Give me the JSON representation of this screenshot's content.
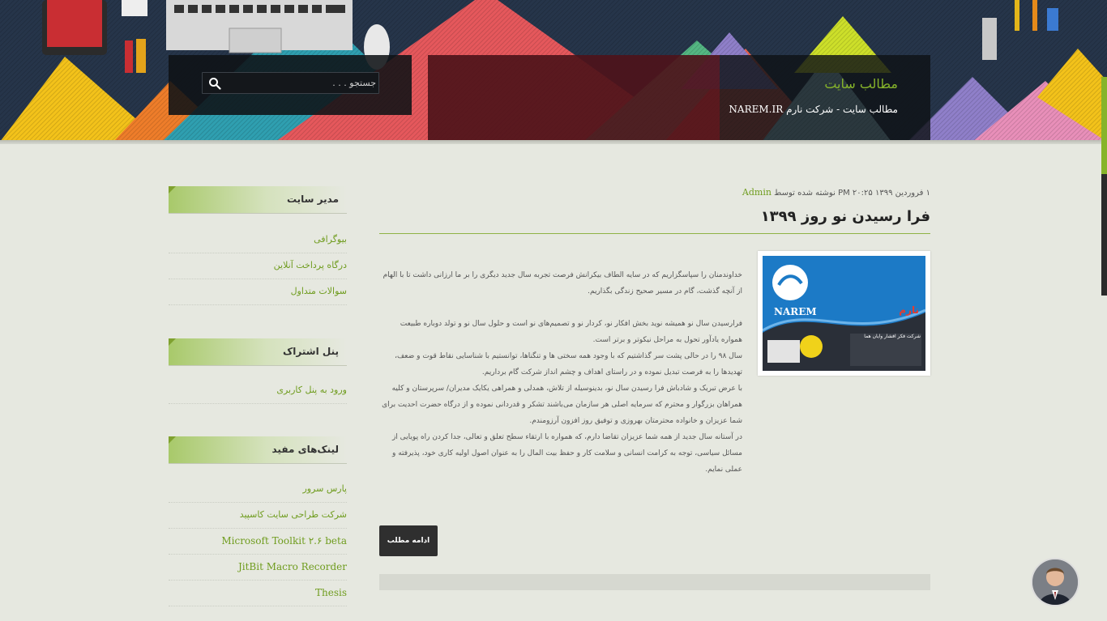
{
  "header": {
    "site_title": "مطالب سایت",
    "site_description": "مطالب سایت - شرکت نارم NAREM.IR",
    "search_placeholder": "جستجو . . ."
  },
  "sidebar": {
    "widgets": [
      {
        "title": "مدیر سایت",
        "links": [
          "بیوگرافی",
          "درگاه پرداخت آنلاین",
          "سوالات متداول"
        ]
      },
      {
        "title": "پنل اشتراک",
        "links": [
          "ورود به پنل کاربری"
        ]
      },
      {
        "title": "لینک‌های مفید",
        "links": [
          "پارس سرور",
          "شرکت طراحی سایت کاسپید",
          "Microsoft Toolkit ۲.۶ beta",
          "JitBit Macro Recorder",
          "Thesis"
        ]
      }
    ]
  },
  "post": {
    "meta_prefix": "۱ فروردین ۱۳۹۹ ۲۰:۲۵ PM نوشته شده توسط",
    "author": "Admin",
    "title": "فرا رسیدن نو روز ۱۳۹۹",
    "paragraphs": [
      "خداوندمنان را سپاسگزاریم که در سایه الطاف بیکرانش فرصت تجربه سال جدید دیگری را بر ما ارزانی داشت تا با الهام از آنچه گذشت، گام در مسیر صحیح زندگی بگذاریم.",
      "فرارسیدن سال نو همیشه نوید بخش افکار نو، کردار نو و تصمیم‌های نو است و حلول سال نو و تولد دوباره طبیعت همواره یادآور تحول به مراحل نیکوتر و برتر است.",
      "سال ۹۸ را در حالی پشت سر گذاشتیم که با وجود همه سختی ها و تنگناها، توانستیم با شناسایی نقاط قوت و ضعف، تهدیدها را به فرصت تبدیل نموده و در راستای اهداف و چشم انداز شرکت گام برداریم.",
      "با عرض تبریک و شادباش فرا رسیدن سال نو، بدینوسیله از تلاش، همدلی و همراهی یکایک مدیران/ سرپرستان و کلیه همراهان بزرگوار و محترم که سرمایه اصلی هر سازمان می‌باشند تشکر و قدردانی نموده و از درگاه حضرت احدیت برای شما عزیزان و خانواده محترمتان بهروزی و توفیق روز افزون آرزومندم.",
      "در آستانه سال جدید از همه شما عزیزان تقاضا دارم، که همواره با ارتقاء سطح تعلق و تعالی، جدا کردن راه پویایی از مسائل سیاسی، توجه به کرامت انسانی و سلامت کار و حفظ بیت المال را به عنوان اصول اولیه کاری خود، پذیرفته و عملی نمایم."
    ],
    "read_more": "ادامه مطلب",
    "thumbnail": {
      "logo": "NAREM",
      "persian_text": "نارم",
      "caption": "شرکت فکر افشار وایان هما"
    }
  },
  "colors": {
    "accent": "#86b42a",
    "header_bg": "#26354a",
    "page_bg": "#e6e8e0"
  }
}
